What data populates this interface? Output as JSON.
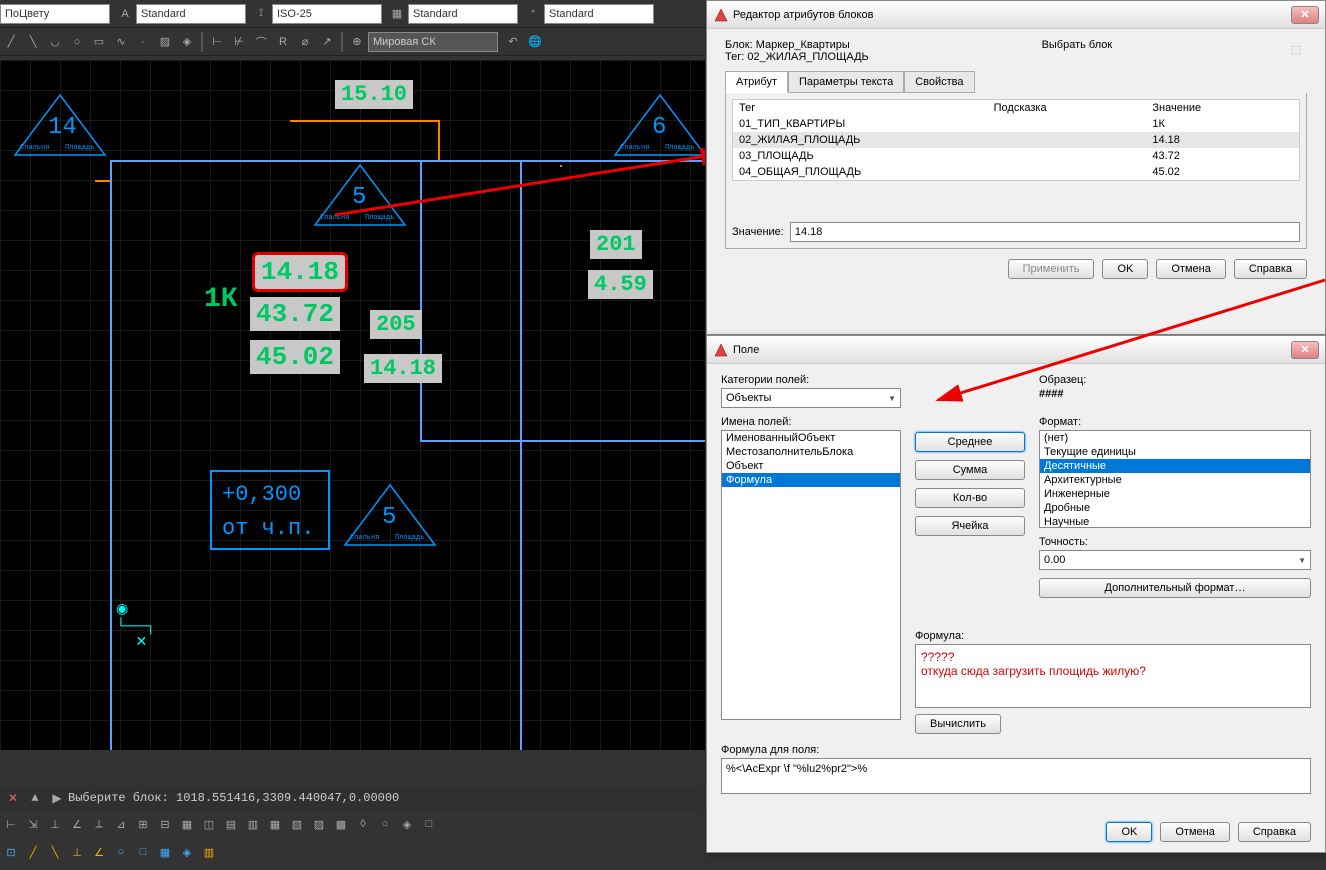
{
  "toolbar": {
    "color_combo": "ПоЦвету",
    "text_style1": "Standard",
    "dim_style": "ISO-25",
    "style3": "Standard",
    "style4": "Standard",
    "ucs": "Мировая СК"
  },
  "canvas": {
    "labels": {
      "a": "15.10",
      "b": "14.18",
      "c": "43.72",
      "d": "45.02",
      "e": "1К",
      "f": "201",
      "g": "4.59",
      "h": "205",
      "i": "14.18",
      "level1": "+0,300",
      "level2": "от ч.п.",
      "tri_num14": "14",
      "tri_num5a": "5",
      "tri_num6": "6",
      "tri_num5b": "5",
      "tri_label_l": "Спальня",
      "tri_label_r": "Площадь"
    }
  },
  "command": "Выберите блок: 1018.551416,3309.440047,0.00000",
  "attr_editor": {
    "title": "Редактор атрибутов блоков",
    "block_label": "Блок:",
    "block_name": "Маркер_Квартиры",
    "tag_label": "Тег:",
    "tag_value": "02_ЖИЛАЯ_ПЛОЩАДЬ",
    "select_block": "Выбрать блок",
    "tabs": {
      "attr": "Атрибут",
      "text": "Параметры текста",
      "props": "Свойства"
    },
    "table": {
      "col_tag": "Тег",
      "col_prompt": "Подсказка",
      "col_value": "Значение",
      "rows": [
        {
          "tag": "01_ТИП_КВАРТИРЫ",
          "prompt": "",
          "value": "1К"
        },
        {
          "tag": "02_ЖИЛАЯ_ПЛОЩАДЬ",
          "prompt": "",
          "value": "14.18"
        },
        {
          "tag": "03_ПЛОЩАДЬ",
          "prompt": "",
          "value": "43.72"
        },
        {
          "tag": "04_ОБЩАЯ_ПЛОЩАДЬ",
          "prompt": "",
          "value": "45.02"
        }
      ]
    },
    "value_label": "Значение:",
    "value_input": "14.18",
    "apply": "Применить",
    "ok": "OK",
    "cancel": "Отмена",
    "help": "Справка"
  },
  "field": {
    "title": "Поле",
    "cat_label": "Категории полей:",
    "cat_value": "Объекты",
    "names_label": "Имена полей:",
    "names": [
      "ИменованныйОбъект",
      "МестозаполнительБлока",
      "Объект",
      "Формула"
    ],
    "sample_label": "Образец:",
    "sample_value": "####",
    "format_label": "Формат:",
    "formats": [
      "(нет)",
      "Текущие единицы",
      "Десятичные",
      "Архитектурные",
      "Инженерные",
      "Дробные",
      "Научные"
    ],
    "precision_label": "Точность:",
    "precision_value": "0.00",
    "more_format": "Дополнительный формат…",
    "formula_label": "Формула:",
    "formula_question": "?????\nоткуда сюда загрузить площидь жилую?",
    "btn_avg": "Среднее",
    "btn_sum": "Сумма",
    "btn_count": "Кол-во",
    "btn_cell": "Ячейка",
    "btn_calc": "Вычислить",
    "result_label": "Формула для поля:",
    "result_value": "%<\\AcExpr  \\f \"%lu2%pr2\">%",
    "ok": "OK",
    "cancel": "Отмена",
    "help": "Справка"
  }
}
